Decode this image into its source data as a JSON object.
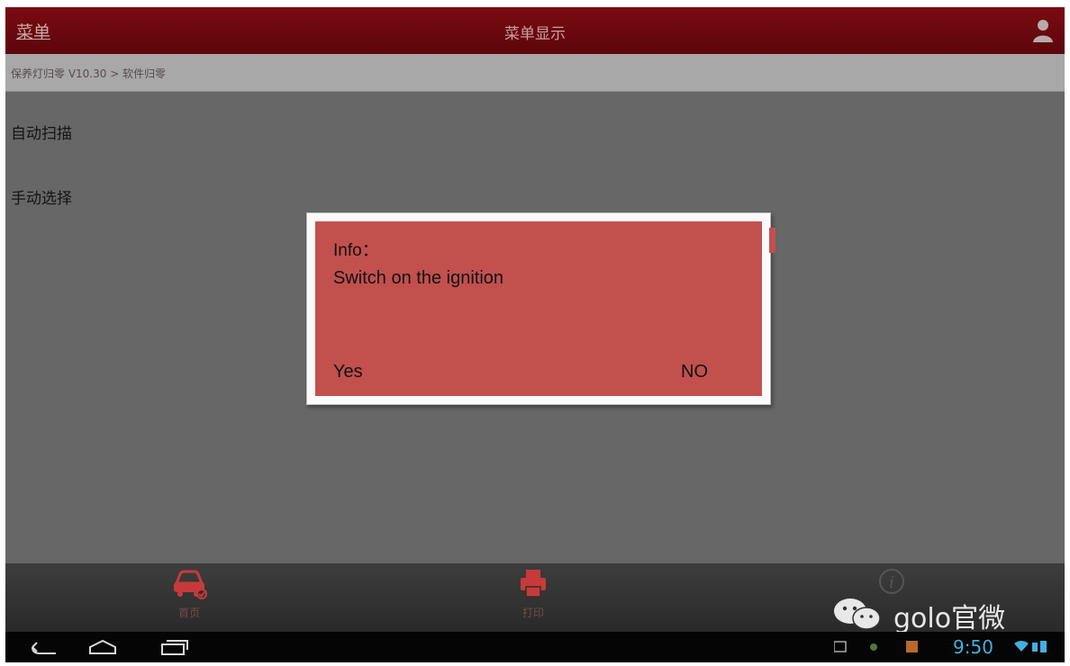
{
  "titlebar": {
    "menu_label": "菜单",
    "title": "菜单显示"
  },
  "breadcrumb": "保养灯归零 V10.30 > 软件归零",
  "menu_items": [
    {
      "label": "自动扫描"
    },
    {
      "label": "手动选择"
    }
  ],
  "dialog": {
    "title": "Info：",
    "message": "Switch on the ignition",
    "yes_label": "Yes",
    "no_label": "NO"
  },
  "toolbar": {
    "home_label": "首页",
    "print_label": "打印",
    "info_icon": "info-icon"
  },
  "watermark": "golo官微",
  "statusbar": {
    "time": "9:50"
  },
  "colors": {
    "titlebar": "#6b0810",
    "dialog": "#c2504d",
    "accent": "#c83a3a"
  }
}
